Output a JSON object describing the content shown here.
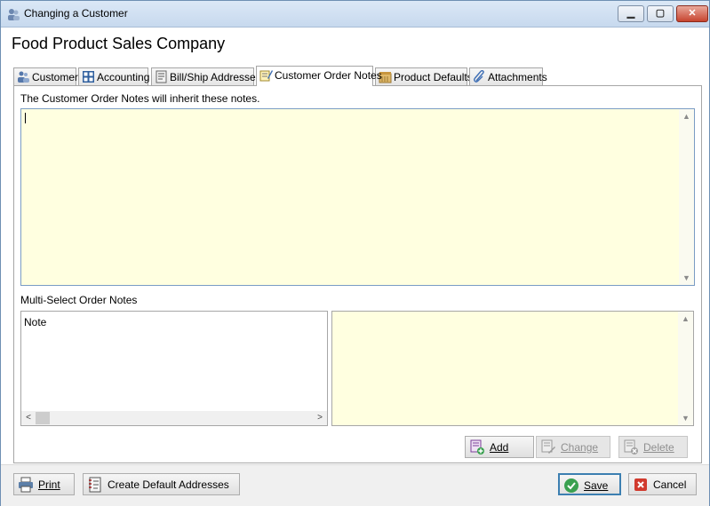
{
  "window": {
    "title": "Changing a Customer",
    "minimize_glyph": "▭",
    "maximize_glyph": "▢",
    "close_glyph": "✕"
  },
  "company_name": "Food Product Sales Company",
  "tabs": [
    {
      "label": "Customer",
      "icon": "customer-icon",
      "active": false
    },
    {
      "label": "Accounting",
      "icon": "accounting-icon",
      "active": false
    },
    {
      "label": "Bill/Ship Addresses",
      "icon": "address-icon",
      "active": false
    },
    {
      "label": "Customer Order Notes",
      "icon": "notes-icon",
      "active": true
    },
    {
      "label": "Product Defaults",
      "icon": "product-icon",
      "active": false
    },
    {
      "label": "Attachments",
      "icon": "paperclip-icon",
      "active": false
    }
  ],
  "notes_panel": {
    "inherit_label": "The Customer Order Notes will inherit these notes.",
    "notes_text": "",
    "multi_select_label": "Multi-Select Order Notes",
    "list_header": "Note",
    "selected_note_text": ""
  },
  "note_buttons": {
    "add": "Add",
    "change": "Change",
    "delete": "Delete"
  },
  "footer": {
    "print": "Print",
    "create_default_addresses": "Create Default Addresses",
    "save": "Save",
    "cancel": "Cancel"
  },
  "colors": {
    "notes_background": "#ffffe0",
    "save_check": "#3aa050",
    "cancel_x": "#d13a2e",
    "titlebar": "#c7d9ee"
  }
}
